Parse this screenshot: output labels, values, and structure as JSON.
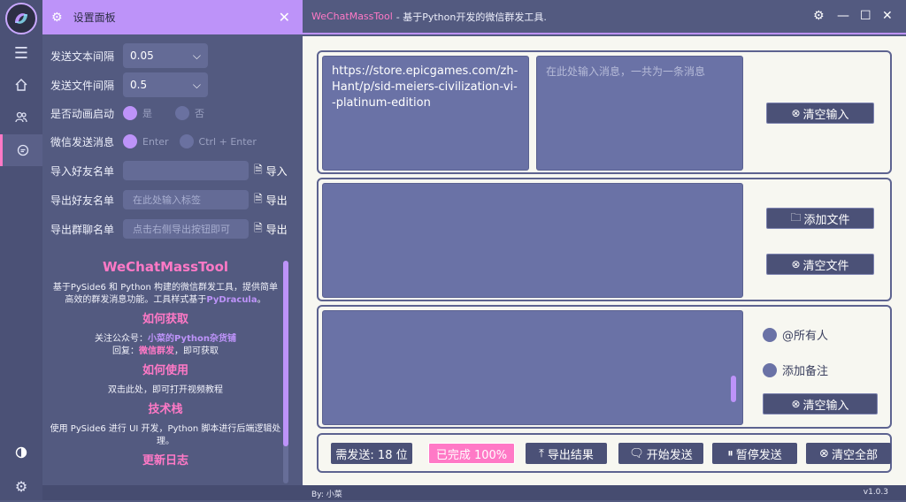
{
  "window": {
    "app_name": "WeChatMassTool",
    "subtitle": "- 基于Python开发的微信群发工具."
  },
  "panel": {
    "title": "设置面板",
    "rows": {
      "text_interval_label": "发送文本间隔",
      "text_interval_value": "0.05",
      "file_interval_label": "发送文件间隔",
      "file_interval_value": "0.5",
      "animation_label": "是否动画启动",
      "animation_yes": "是",
      "animation_no": "否",
      "send_key_label": "微信发送消息",
      "send_key_enter": "Enter",
      "send_key_ctrl": "Ctrl + Enter",
      "import_label": "导入好友名单",
      "import_action": "导入",
      "export_friends_label": "导出好友名单",
      "export_friends_placeholder": "在此处输入标签",
      "export_friends_action": "导出",
      "export_groups_label": "导出群聊名单",
      "export_groups_placeholder": "点击右侧导出按钮即可",
      "export_groups_action": "导出"
    },
    "info": {
      "title": "WeChatMassTool",
      "desc_1": "基于PySide6 和 Python 构建的微信群发工具，提供简单高效的群发消息功能。工具样式基于",
      "desc_link": "PyDracula",
      "desc_end": "。",
      "get_title": "如何获取",
      "get_line1_prefix": "关注公众号：",
      "get_line1_name": "小菜的Python杂货铺",
      "get_line2_prefix": "回复：",
      "get_line2_word": "微信群发",
      "get_line2_suffix": "，即可获取",
      "use_title": "如何使用",
      "use_line": "双击此处，即可打开视频教程",
      "stack_title": "技术栈",
      "stack_line": "使用 PySide6 进行 UI 开发，Python 脚本进行后端逻辑处理。",
      "more_title": "更新日志"
    }
  },
  "main": {
    "names_text": "https://store.epicgames.com/zh-Hant/p/sid-meiers-civilization-vi--platinum-edition",
    "message_placeholder": "在此处输入消息，一共为一条消息",
    "clear_input_label": "清空输入",
    "add_file_label": "添加文件",
    "clear_file_label": "清空文件",
    "at_all_label": "@所有人",
    "add_remark_label": "添加备注",
    "clear_input2_label": "清空输入"
  },
  "bottom": {
    "need_send": "需发送: 18 位",
    "done": "已完成 100%",
    "export_result": "导出结果",
    "start_send": "开始发送",
    "pause_send": "暂停发送",
    "clear_all": "清空全部"
  },
  "status": {
    "author": "By: 小菜",
    "version": "v1.0.3"
  },
  "colors": {
    "accent_purple": "#bd93f9",
    "accent_pink": "#ff79c6",
    "panel_bg": "#535a80",
    "content_bg": "#f7f7f1"
  }
}
